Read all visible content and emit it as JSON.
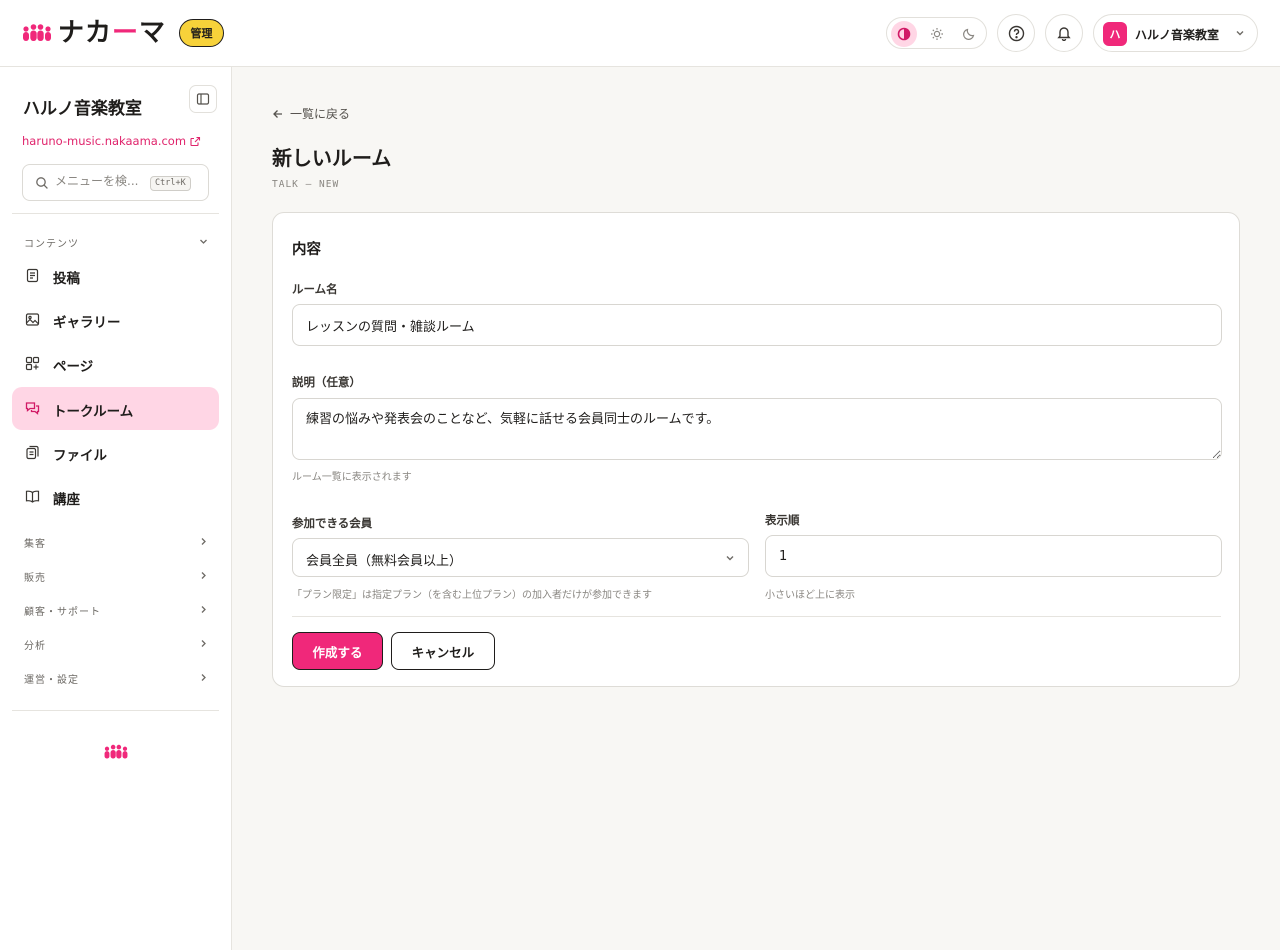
{
  "header": {
    "logo_text_a": "ナカ",
    "logo_text_accent": "ー",
    "logo_text_b": "マ",
    "admin_badge": "管理",
    "org_avatar": "ハ",
    "org_name": "ハルノ音楽教室"
  },
  "sidebar": {
    "site_title": "ハルノ音楽教室",
    "site_url": "haruno-music.nakaama.com",
    "search_placeholder": "メニューを検...",
    "search_shortcut": "Ctrl+K",
    "content_section": "コンテンツ",
    "items": [
      {
        "label": "投稿",
        "icon": "document-icon"
      },
      {
        "label": "ギャラリー",
        "icon": "image-icon"
      },
      {
        "label": "ページ",
        "icon": "page-grid-icon"
      },
      {
        "label": "トークルーム",
        "icon": "chat-icon",
        "active": true
      },
      {
        "label": "ファイル",
        "icon": "files-icon"
      },
      {
        "label": "講座",
        "icon": "book-icon"
      }
    ],
    "sections": [
      "集客",
      "販売",
      "顧客・サポート",
      "分析",
      "運営・設定"
    ]
  },
  "main": {
    "back_link": "一覧に戻る",
    "page_title": "新しいルーム",
    "page_subtitle": "TALK — NEW",
    "card_title": "内容",
    "room_name_label": "ルーム名",
    "room_name_value": "レッスンの質問・雑談ルーム",
    "desc_label": "説明（任意）",
    "desc_value": "練習の悩みや発表会のことなど、気軽に話せる会員同士のルームです。",
    "desc_help": "ルーム一覧に表示されます",
    "members_label": "参加できる会員",
    "members_value": "会員全員（無料会員以上）",
    "members_help": "「プラン限定」は指定プラン（を含む上位プラン）の加入者だけが参加できます",
    "order_label": "表示順",
    "order_value": "1",
    "order_help": "小さいほど上に表示",
    "create_button": "作成する",
    "cancel_button": "キャンセル"
  },
  "colors": {
    "accent": "#f0287a",
    "accent_soft": "#ffd6e5",
    "badge": "#f7d23a"
  }
}
